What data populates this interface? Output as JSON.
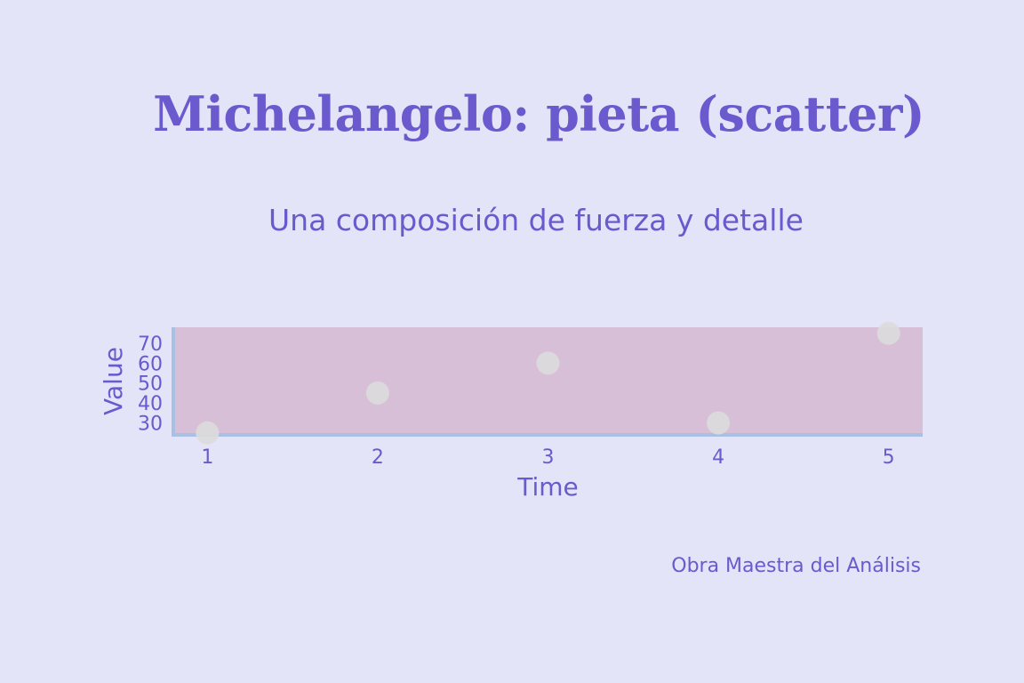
{
  "header": {
    "title": "Michelangelo: pieta (scatter)",
    "subtitle": "Una composición de fuerza y detalle"
  },
  "footer": {
    "caption": "Obra Maestra del Análisis"
  },
  "colors": {
    "background": "#e4e4f8",
    "text": "#6a5acd",
    "plot_area": "#d8bfd8",
    "axis_line": "#a7c0e3",
    "marker": "#dcdcdc"
  },
  "chart_data": {
    "type": "scatter",
    "x": [
      1,
      2,
      3,
      4,
      5
    ],
    "y": [
      25,
      45,
      60,
      30,
      75
    ],
    "xlabel": "Time",
    "ylabel": "Value",
    "x_ticks": [
      "1",
      "2",
      "3",
      "4",
      "5"
    ],
    "y_ticks": [
      "30",
      "40",
      "50",
      "60",
      "70"
    ],
    "xlim": [
      0.8,
      5.2
    ],
    "ylim": [
      24,
      78
    ],
    "grid": false,
    "legend": false
  }
}
